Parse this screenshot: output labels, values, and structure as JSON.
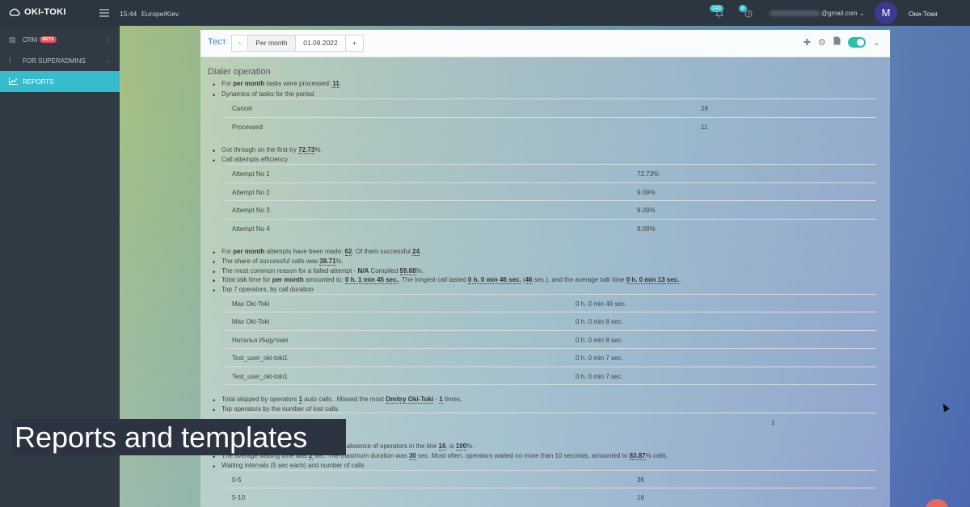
{
  "topbar": {
    "logo": "OKI-TOKI",
    "time": "15:44",
    "timezone": "Europe/Kiev",
    "notif1_count": "243",
    "notif2_count": "8",
    "email_suffix": "@gmail.com",
    "avatar_letter": "M",
    "username": "Оки-Токи"
  },
  "sidebar": {
    "items": [
      {
        "label": "CRM",
        "badge": "BETA"
      },
      {
        "label": "FOR SUPERADMINS"
      },
      {
        "label": "REPORTS"
      }
    ]
  },
  "panel": {
    "title": "Тест",
    "minus": "-",
    "period": "Per month",
    "date": "01.09.2022",
    "plus": "+",
    "heading": "Dialer operation"
  },
  "report": {
    "tasks_line": {
      "a": "For ",
      "b": "per month",
      "c": " tasks were processed: ",
      "d": "11",
      "e": "."
    },
    "dynamics_title": "Dynamics of tasks for the period",
    "dynamics": [
      {
        "name": "Cancel",
        "value": "28"
      },
      {
        "name": "Processed",
        "value": "11"
      }
    ],
    "first_try": {
      "a": "Got through on the first try ",
      "b": "72.73",
      "c": "%."
    },
    "efficiency_title": "Call attempts efficiency",
    "attempts": [
      {
        "name": "Attempt No 1",
        "value": "72.73%"
      },
      {
        "name": "Attempt No 2",
        "value": "9.09%"
      },
      {
        "name": "Attempt No 3",
        "value": "9.09%"
      },
      {
        "name": "Attempt No 4",
        "value": "9.09%"
      }
    ],
    "attempts_line": {
      "a": "For ",
      "b": "per month",
      "c": " attempts have been made: ",
      "d": "62",
      "e": ". Of them successful ",
      "f": "24",
      "g": "."
    },
    "share_line": {
      "a": "The share of successful calls was ",
      "b": "38.71",
      "c": "%."
    },
    "reason_line": {
      "a": "The most common reason for a failed attempt - ",
      "b": "N/A",
      "c": " Compiled ",
      "d": "59.68",
      "e": "%."
    },
    "talk_line": {
      "a": "Total talk time for ",
      "b": "per month",
      "c": " amounted to: ",
      "d": "0 h. 1 min 45 sec.",
      "e": ". The longest call lasted ",
      "f": "0 h. 0 min 46 sec.",
      "g": " (",
      "h": "46",
      "i": " sec.), and the average talk time ",
      "j": "0 h. 0 min 13 sec.",
      "k": "."
    },
    "top7_title": "Top 7 operators, by call duration",
    "top7": [
      {
        "name": "Max Oki-Toki",
        "value": "0 h. 0 min 46 sec."
      },
      {
        "name": "Max Oki-Toki",
        "value": "0 h. 0 min 8 sec."
      },
      {
        "name": "Наталья Индутная",
        "value": "0 h. 0 min 8 sec."
      },
      {
        "name": "Test_user_oki-toki1",
        "value": "0 h. 0 min 7 sec."
      },
      {
        "name": "Test_user_oki-toki1",
        "value": "0 h. 0 min 7 sec."
      }
    ],
    "skipped_line": {
      "a": "Total skipped by operators ",
      "b": "1",
      "c": " auto calls.. Missed the most ",
      "d": "Dmitry Oki-Toki",
      "e": " - ",
      "f": "1",
      "g": " times."
    },
    "lost_title": "Top operators by the number of lost calls",
    "lost_value": "1",
    "absence_line": {
      "a": "e absence of operators in the line ",
      "b": "16",
      "c": ", is ",
      "d": "100",
      "e": "%."
    },
    "waiting_line": {
      "a": "The average waiting time was ",
      "b": "2",
      "c": " sec. The maximum duration was ",
      "d": "30",
      "e": " sec. Most often, operators waited no more than 10 seconds, amounted to ",
      "f": "83.87",
      "g": "% calls."
    },
    "intervals_title": "Waiting intervals (5 sec each) and number of calls",
    "intervals": [
      {
        "name": "0-5",
        "value": "36"
      },
      {
        "name": "5-10",
        "value": "16"
      }
    ]
  },
  "caption": "Reports and templates"
}
